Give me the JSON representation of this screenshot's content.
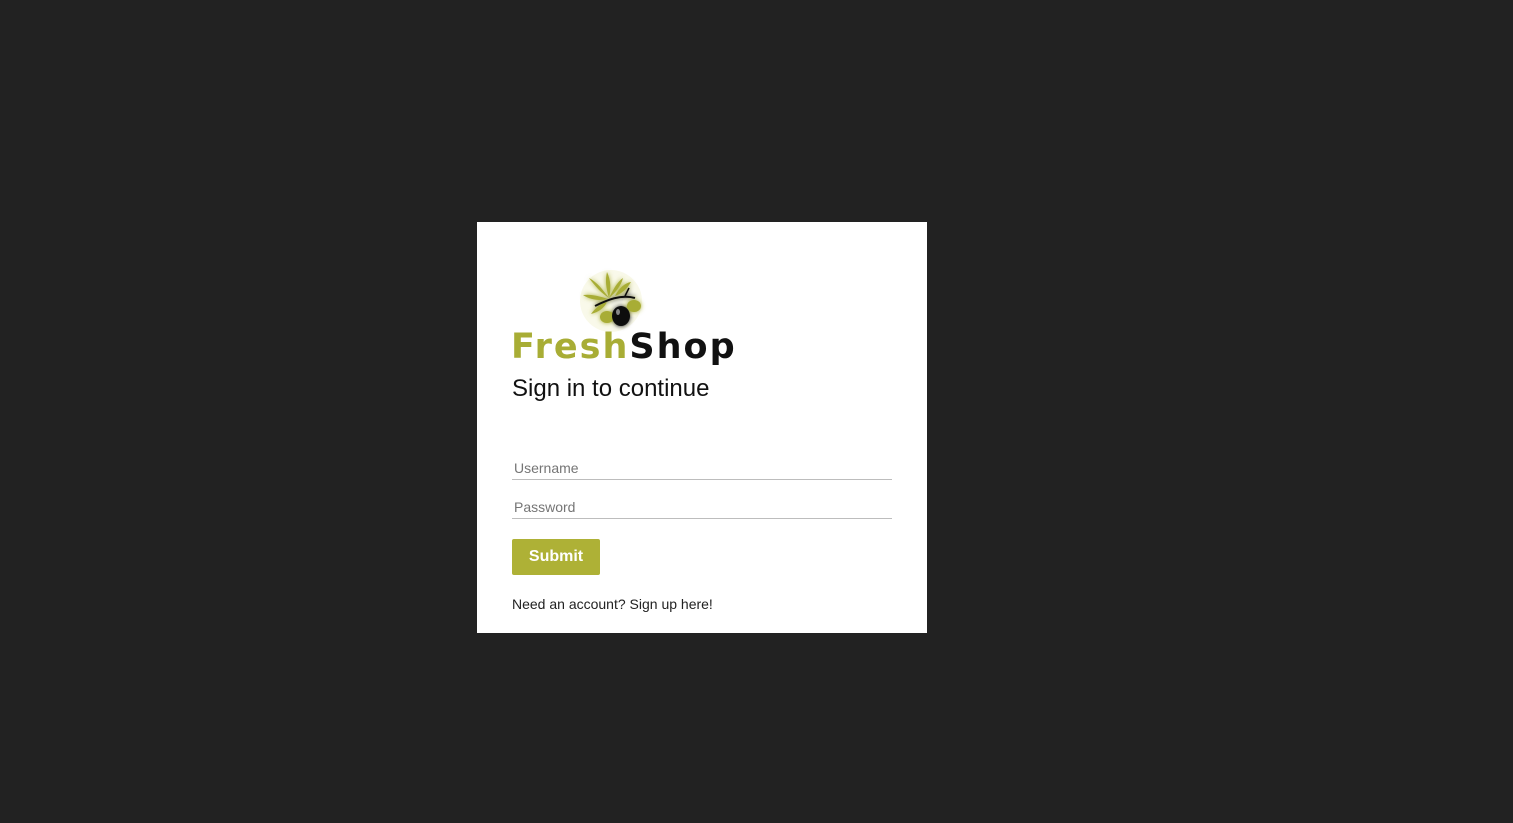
{
  "logo": {
    "brand_part1": "Fresh",
    "brand_part2": "Shop",
    "accent_color": "#a8ad35",
    "icon": "olive-branch-icon"
  },
  "login": {
    "title": "Sign in to continue",
    "username_placeholder": "Username",
    "username_value": "",
    "password_placeholder": "Password",
    "password_value": "",
    "submit_label": "Submit",
    "signup_prompt": "Need an account? ",
    "signup_link": "Sign up here!"
  },
  "colors": {
    "background": "#222222",
    "card": "#ffffff",
    "button": "#aeb136"
  }
}
